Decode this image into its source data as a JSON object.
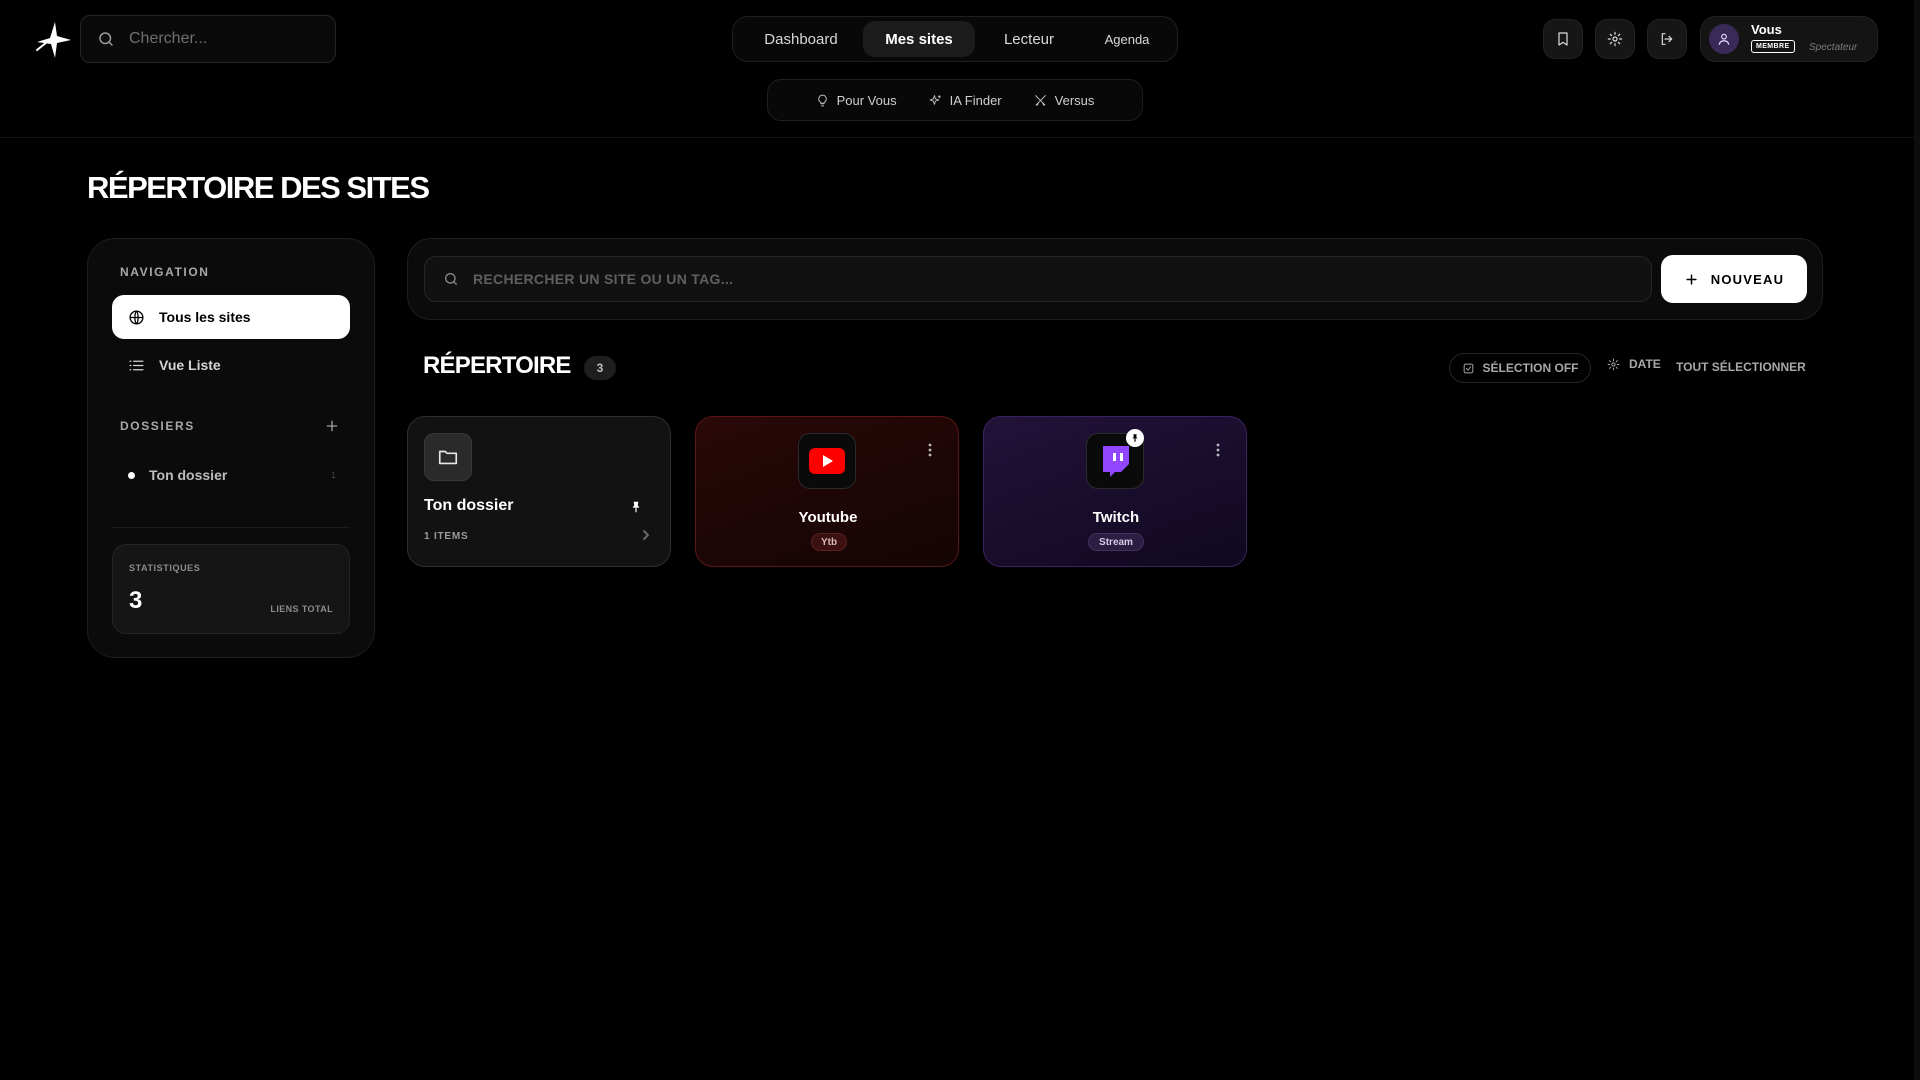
{
  "header": {
    "search_placeholder": "Chercher...",
    "tabs": [
      {
        "label": "Dashboard"
      },
      {
        "label": "Mes sites",
        "active": true
      },
      {
        "label": "Lecteur"
      },
      {
        "label": "Agenda"
      }
    ],
    "subtabs": [
      {
        "label": "Pour Vous",
        "icon": "lightbulb-icon"
      },
      {
        "label": "IA Finder",
        "icon": "sparkles-icon"
      },
      {
        "label": "Versus",
        "icon": "swords-icon"
      }
    ],
    "actions": [
      "bookmark-icon",
      "gear-icon",
      "logout-icon"
    ],
    "user": {
      "name": "Vous",
      "badge": "MEMBRE",
      "role": "Spectateur"
    }
  },
  "page": {
    "title": "RÉPERTOIRE DES SITES"
  },
  "sidebar": {
    "navigation_heading": "NAVIGATION",
    "nav_items": [
      {
        "label": "Tous les sites",
        "icon": "globe-icon",
        "active": true
      },
      {
        "label": "Vue Liste",
        "icon": "list-icon"
      }
    ],
    "folders_heading": "DOSSIERS",
    "folders": [
      {
        "name": "Ton dossier",
        "count": "1"
      }
    ],
    "stats": {
      "label": "STATISTIQUES",
      "value": "3",
      "sub": "LIENS TOTAL"
    }
  },
  "main": {
    "search_placeholder": "RECHERCHER UN SITE OU UN TAG...",
    "new_button": "NOUVEAU",
    "directory_title": "RÉPERTOIRE",
    "directory_count": "3",
    "toolbar": {
      "selection": "SÉLECTION OFF",
      "sort": "DATE",
      "select_all": "TOUT SÉLECTIONNER"
    },
    "cards": [
      {
        "type": "folder",
        "name": "Ton dossier",
        "count_label": "1 ITEMS",
        "pinned": true
      },
      {
        "type": "site",
        "name": "Youtube",
        "tag": "Ytb",
        "icon": "youtube-icon",
        "accent": "#ff0000"
      },
      {
        "type": "site",
        "name": "Twitch",
        "tag": "Stream",
        "icon": "twitch-icon",
        "accent": "#9146ff",
        "pinned": true
      }
    ]
  },
  "colors": {
    "background": "#000000",
    "youtube": "#ff0000",
    "twitch": "#9146ff"
  }
}
